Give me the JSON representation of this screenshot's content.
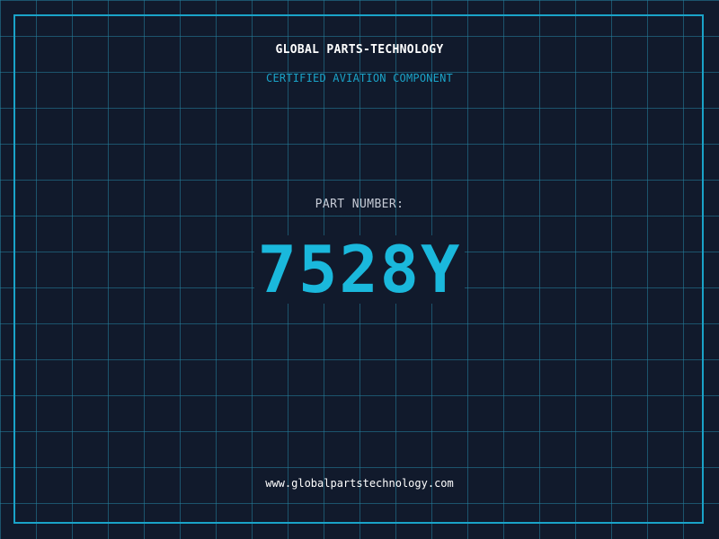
{
  "header": {
    "company_name": "GLOBAL PARTS-TECHNOLOGY",
    "tagline": "CERTIFIED AVIATION COMPONENT"
  },
  "part": {
    "label": "PART NUMBER:",
    "number": "7528Y"
  },
  "footer": {
    "website": "www.globalpartstechnology.com"
  },
  "colors": {
    "background": "#111a2c",
    "grid": "#2482a0",
    "accent": "#1aa3c8",
    "part_number": "#1ab8dc",
    "label": "#c6cbd6",
    "text": "#ffffff"
  }
}
